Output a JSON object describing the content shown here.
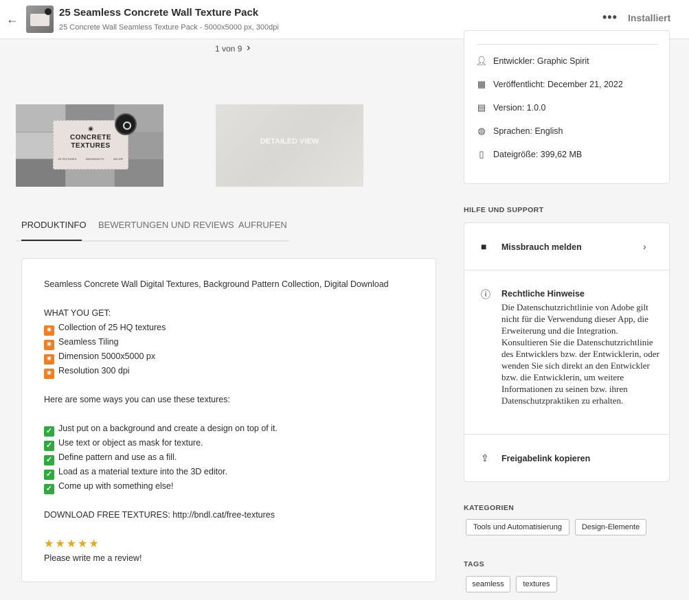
{
  "header": {
    "back_icon": "arrow-left-icon",
    "title": "25 Seamless Concrete Wall Texture Pack",
    "subtitle": "25 Concrete Wall Seamless Texture Pack - 5000x5000 px, 300dpi",
    "more_label": "•••",
    "installed_label": "Installiert"
  },
  "gallery": {
    "pager": "1 von 9",
    "next_icon": "chevron-right-icon",
    "thumb1": {
      "card_title": "CONCRETE TEXTURES",
      "card_specs": [
        "25 TEXTURES",
        "5000X5000 PX",
        "300 DPI"
      ]
    },
    "thumb2": {
      "watermark": "DETAILED VIEW"
    }
  },
  "tabs": [
    {
      "label": "PRODUKTINFO",
      "active": true
    },
    {
      "label": "BEWERTUNGEN UND REVIEWS",
      "active": false
    },
    {
      "label": "AUFRUFEN",
      "active": false
    }
  ],
  "description": {
    "intro": "Seamless Concrete Wall Digital Textures, Background Pattern Collection, Digital Download",
    "what_heading": "WHAT YOU GET:",
    "what_items": [
      "Collection of 25 HQ textures",
      "Seamless Tiling",
      "Dimension 5000x5000 px",
      "Resolution 300 dpi"
    ],
    "ways_heading": "Here are some ways you can use these textures:",
    "ways_items": [
      "Just put on a background and create a design on top of it.",
      "Use text or object as mask for texture.",
      "Define pattern and use as a fill.",
      "Load as a material texture into the 3D editor.",
      "Come up with something else!"
    ],
    "download": "DOWNLOAD FREE TEXTURES: http://bndl.cat/free-textures",
    "stars": "★★★★★",
    "review_request": "Please write me a review!"
  },
  "info": {
    "developer": "Entwickler: Graphic Spirit",
    "published": "Veröffentlicht: December 21, 2022",
    "version": "Version: 1.0.0",
    "languages": "Sprachen: English",
    "filesize": "Dateigröße: 399,62 MB"
  },
  "support": {
    "section_title": "HILFE UND SUPPORT",
    "report_label": "Missbrauch melden",
    "legal_title": "Rechtliche Hinweise",
    "legal_text": "Die Datenschutzrichtlinie von Adobe gilt nicht für die Verwendung dieser App, die Erweiterung und die Integration. Konsultieren Sie die Datenschutzrichtlinie des Entwicklers bzw. der Entwicklerin, oder wenden Sie sich direkt an den Entwickler bzw. die Entwicklerin, um weitere Informationen zu seinen bzw. ihren Datenschutzpraktiken zu erhalten.",
    "share_label": "Freigabelink kopieren"
  },
  "categories": {
    "section_title": "KATEGORIEN",
    "items": [
      "Tools und Automatisierung",
      "Design-Elemente"
    ]
  },
  "tags": {
    "section_title": "TAGS",
    "items": [
      "seamless",
      "textures"
    ]
  }
}
